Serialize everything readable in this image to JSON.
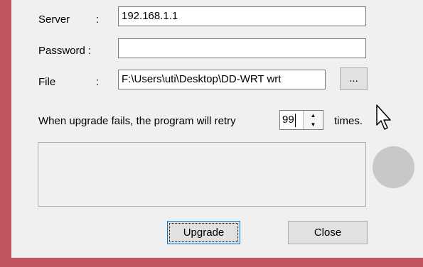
{
  "form": {
    "server": {
      "label": "Server",
      "colon": ":",
      "value": "192.168.1.1"
    },
    "password": {
      "label": "Password :",
      "value": ""
    },
    "file": {
      "label": "File",
      "colon": ":",
      "value": "F:\\Users\\uti\\Desktop\\DD-WRT wrt",
      "browse_label": "..."
    }
  },
  "retry": {
    "prefix": "When upgrade fails, the program will retry",
    "count": "99",
    "suffix": "times."
  },
  "log": {
    "text": ""
  },
  "buttons": {
    "upgrade": "Upgrade",
    "close": "Close"
  },
  "colors": {
    "frame": "#c2555f",
    "panel": "#f0f0f0",
    "status_circle": "#c8c8c8"
  },
  "icons": {
    "spin_up": "spin-up-arrow",
    "spin_down": "spin-down-arrow",
    "cursor": "mouse-pointer",
    "status": "status-indicator-circle"
  }
}
